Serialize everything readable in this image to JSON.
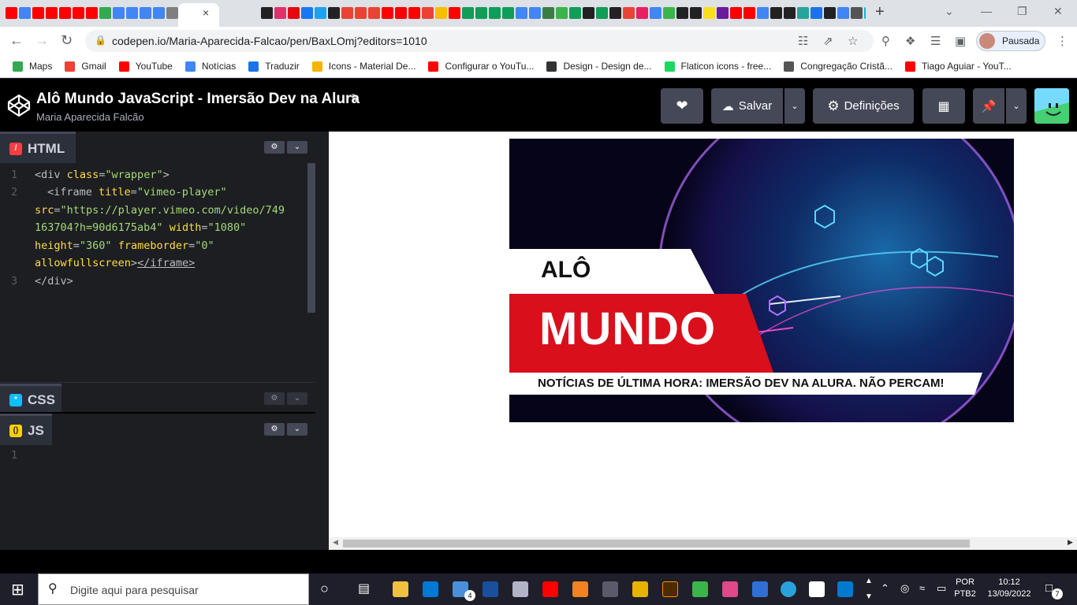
{
  "browser": {
    "tab_title": "Alô Mundo JavaScript - Imersão Dev na Alura",
    "url": "codepen.io/Maria-Aparecida-Falcao/pen/BaxLOmj?editors=1010",
    "profile_label": "Pausada",
    "window_controls": {
      "minimize": "—",
      "maximize": "❐",
      "close": "✕",
      "tab_search": "⌄"
    },
    "new_tab": "+",
    "tab_close": "×"
  },
  "bookmarks": [
    {
      "label": "Maps",
      "color": "#34a853"
    },
    {
      "label": "Gmail",
      "color": "#ea4335"
    },
    {
      "label": "YouTube",
      "color": "#ff0000"
    },
    {
      "label": "Notícias",
      "color": "#4285f4"
    },
    {
      "label": "Traduzir",
      "color": "#1a73e8"
    },
    {
      "label": "Icons - Material De...",
      "color": "#f4b400"
    },
    {
      "label": "Configurar o YouTu...",
      "color": "#ff0000"
    },
    {
      "label": "Design - Design de...",
      "color": "#333333"
    },
    {
      "label": "Flaticon icons - free...",
      "color": "#1ed760"
    },
    {
      "label": "Congregação Cristã...",
      "color": "#555555"
    },
    {
      "label": "Tiago Aguiar - YouT...",
      "color": "#ff0000"
    }
  ],
  "codepen": {
    "title": "Alô Mundo JavaScript - Imersão Dev na Alura",
    "author": "Maria Aparecida Falcão",
    "save_label": "Salvar",
    "settings_label": "Definições"
  },
  "editors": {
    "html": {
      "label": "HTML",
      "accent": "#ff3c41"
    },
    "css": {
      "label": "CSS",
      "accent": "#0ebeff"
    },
    "js": {
      "label": "JS",
      "accent": "#fcd000"
    },
    "html_lines": [
      "1",
      "2",
      "3"
    ],
    "js_lines": [
      "1"
    ],
    "html_code": {
      "l1_open": "<div ",
      "l1_attr": "class",
      "l1_eq": "=",
      "l1_str": "\"wrapper\"",
      "l1_close": ">",
      "l2_open": "<iframe ",
      "l2_attr": "title",
      "l2_eq": "=",
      "l2_str": "\"vimeo-player\"",
      "l3_attr": "src",
      "l3_eq": "=",
      "l3_str": "\"https://player.vimeo.com/video/749",
      "l4_str": "163704?h=90d6175ab4\"",
      "l4_attr": "width",
      "l4_eq": "=",
      "l4_str2": "\"1080\"",
      "l5_attr": "height",
      "l5_eq": "=",
      "l5_str": "\"360\"",
      "l5_attr2": "frameborder",
      "l5_eq2": "=",
      "l5_str2": "\"0\"",
      "l6_attr": "allowfullscreen",
      "l6_close": ">",
      "l6_endtag": "</iframe>",
      "l7": "</div>"
    }
  },
  "video": {
    "line1": "ALÔ",
    "line2": "MUNDO",
    "ticker": "NOTÍCIAS DE ÚLTIMA HORA: IMERSÃO DEV NA ALURA. NÃO PERCAM!"
  },
  "taskbar": {
    "search_placeholder": "Digite aqui para pesquisar",
    "mail_badge": "4",
    "lang_top": "POR",
    "lang_bottom": "PTB2",
    "time": "10:12",
    "date": "13/09/2022",
    "notifications": "7"
  }
}
